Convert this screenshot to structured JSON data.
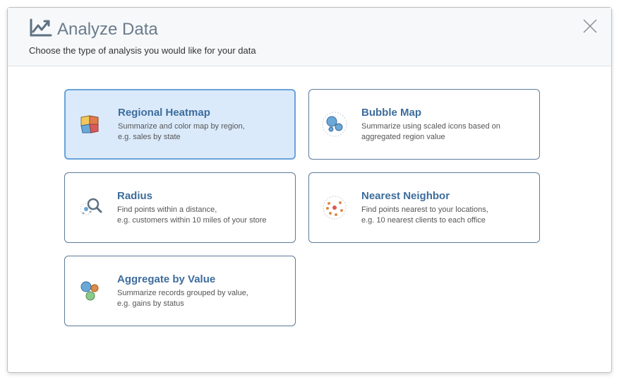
{
  "header": {
    "title": "Analyze Data",
    "subtitle": "Choose the type of analysis you would like for your data"
  },
  "cards": [
    {
      "id": "regional-heatmap",
      "title": "Regional Heatmap",
      "desc": "Summarize and color map by region,\ne.g. sales by state",
      "selected": true
    },
    {
      "id": "bubble-map",
      "title": "Bubble Map",
      "desc": "Summarize using scaled icons based on aggregated region value",
      "selected": false
    },
    {
      "id": "radius",
      "title": "Radius",
      "desc": "Find points within a distance,\ne.g. customers within 10 miles of your store",
      "selected": false
    },
    {
      "id": "nearest-neighbor",
      "title": "Nearest Neighbor",
      "desc": "Find points nearest to your locations,\ne.g. 10 nearest clients to each office",
      "selected": false
    },
    {
      "id": "aggregate-by-value",
      "title": "Aggregate by Value",
      "desc": "Summarize records grouped by value,\ne.g. gains by status",
      "selected": false
    }
  ]
}
